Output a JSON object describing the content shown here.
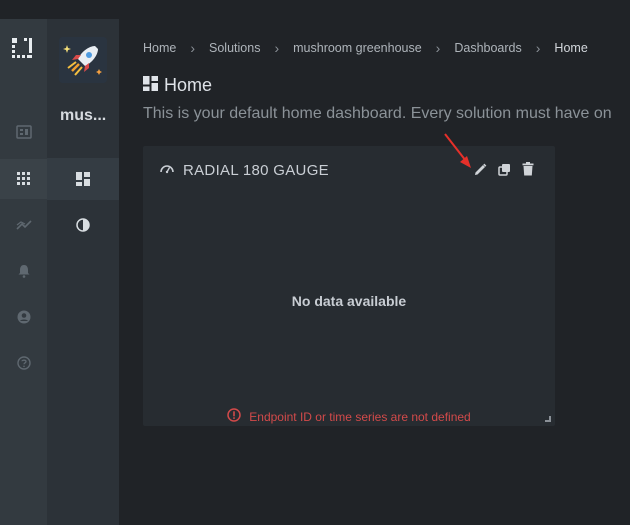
{
  "solution": {
    "name_truncated": "mus..."
  },
  "breadcrumb": {
    "items": [
      "Home",
      "Solutions",
      "mushroom greenhouse",
      "Dashboards"
    ],
    "current": "Home"
  },
  "page": {
    "title": "Home",
    "subtitle": "This is your default home dashboard. Every solution must have on"
  },
  "widget": {
    "title": "RADIAL 180 GAUGE",
    "no_data": "No data available",
    "error": "Endpoint ID or time series are not defined",
    "tools": [
      "edit-icon",
      "duplicate-icon",
      "delete-icon"
    ]
  },
  "rail": {
    "icons": [
      "devices-icon",
      "apps-icon",
      "insights-icon",
      "notifications-icon",
      "account-icon",
      "help-icon"
    ]
  },
  "colors": {
    "error": "#d24a4a",
    "annotation_arrow": "#e5302a"
  }
}
